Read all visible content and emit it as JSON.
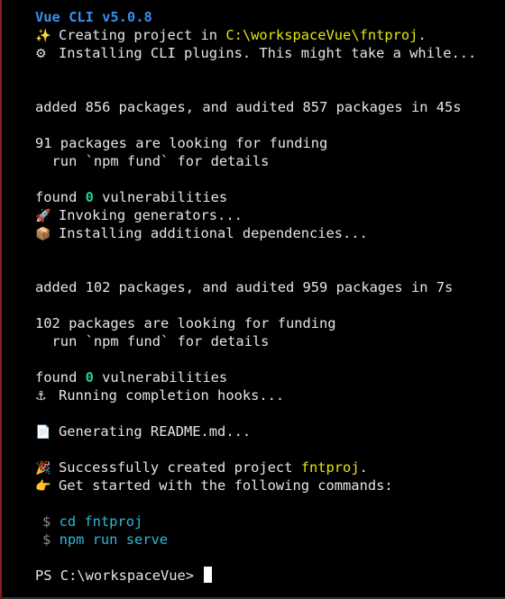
{
  "terminal": {
    "banner": "Vue CLI v5.0.8",
    "creating": {
      "icon": "sparkles-icon",
      "glyph": "✨",
      "text": "Creating project in ",
      "path": "C:\\workspaceVue\\fntproj",
      "suffix": "."
    },
    "installing_plugins": {
      "icon": "gear-icon",
      "glyph": "⚙",
      "text": "Installing CLI plugins. This might take a while..."
    },
    "added_1": "added 856 packages, and audited 857 packages in 45s",
    "funding_1": "91 packages are looking for funding",
    "fund_hint_1": "  run `npm fund` for details",
    "found_1": {
      "prefix": "found ",
      "count": "0",
      "suffix": " vulnerabilities"
    },
    "invoking": {
      "icon": "rocket-icon",
      "glyph": "🚀",
      "text": "Invoking generators..."
    },
    "installing_deps": {
      "icon": "package-icon",
      "glyph": "📦",
      "text": "Installing additional dependencies..."
    },
    "added_2": "added 102 packages, and audited 959 packages in 7s",
    "funding_2": "102 packages are looking for funding",
    "fund_hint_2": "  run `npm fund` for details",
    "found_2": {
      "prefix": "found ",
      "count": "0",
      "suffix": " vulnerabilities"
    },
    "hooks": {
      "icon": "anchor-icon",
      "glyph": "⚓",
      "text": "Running completion hooks..."
    },
    "readme": {
      "icon": "document-icon",
      "glyph": "📄",
      "text": "Generating README.md..."
    },
    "success": {
      "icon": "party-popper-icon",
      "glyph": "🎉",
      "text": "Successfully created project ",
      "project": "fntproj",
      "suffix": "."
    },
    "get_started": {
      "icon": "pointing-hand-icon",
      "glyph": "👉",
      "text": "Get started with the following commands:"
    },
    "commands": [
      {
        "dollar": "$",
        "cmd": "cd fntproj"
      },
      {
        "dollar": "$",
        "cmd": "npm run serve"
      }
    ],
    "prompt": "PS C:\\workspaceVue> "
  },
  "colors": {
    "background": "#000000",
    "text": "#e5e5e5",
    "banner": "#3b8eea",
    "path": "#e5e510",
    "success_count": "#23d18b",
    "command": "#29b8db"
  }
}
